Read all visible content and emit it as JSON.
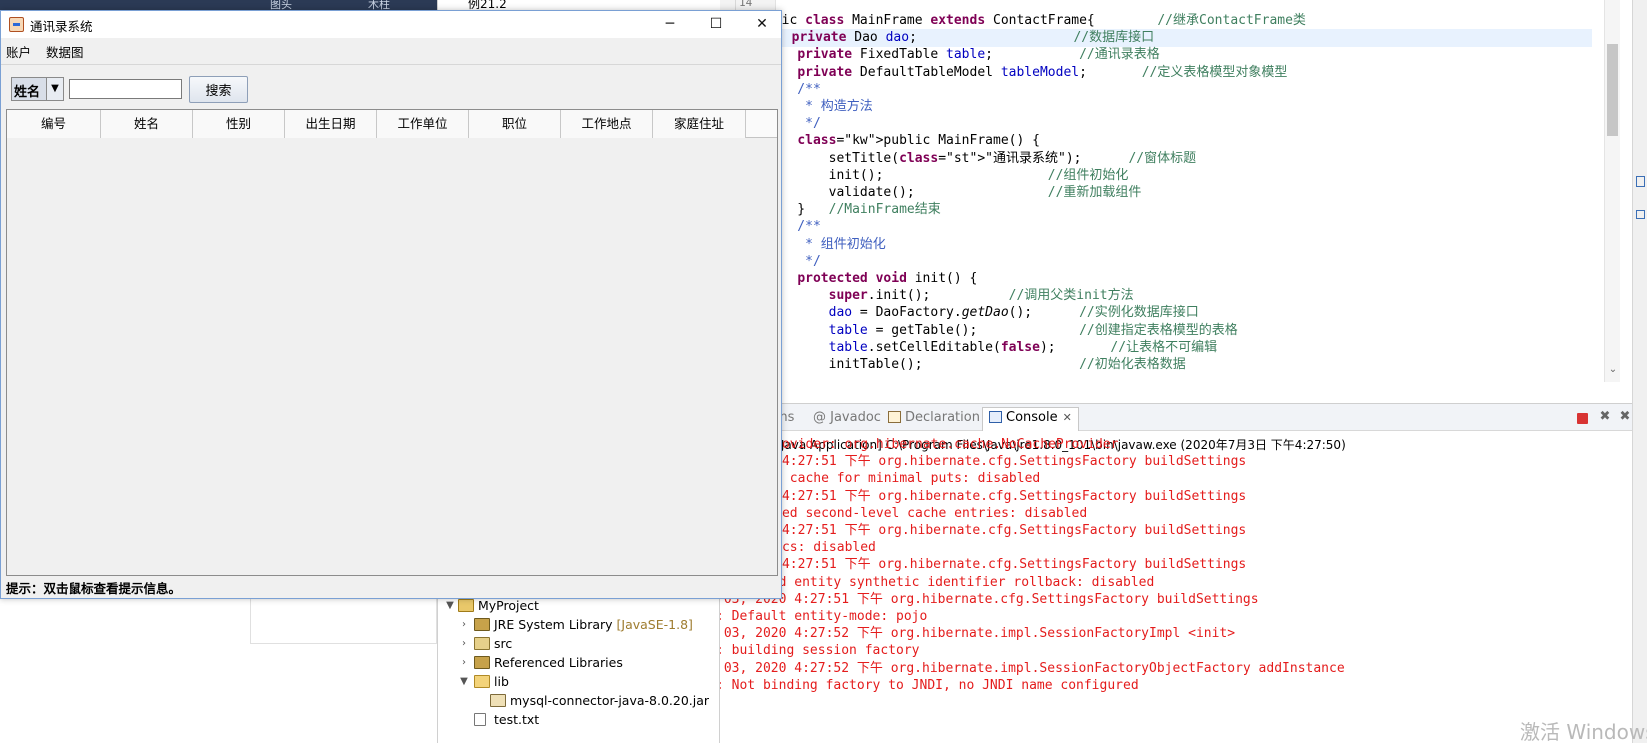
{
  "ide": {
    "top_strip": {
      "left_text": "图头",
      "right_text": "木柱"
    },
    "line_number": "14",
    "explorer_top_item": "例21.2",
    "code_lines": [
      "public class MainFrame extends ContactFrame{        //继承ContactFrame类",
      "    private Dao dao;                    //数据库接口",
      "    private FixedTable table;           //通讯录表格",
      "    private DefaultTableModel tableModel;       //定义表格模型对象模型",
      "    /**",
      "     * 构造方法",
      "     */",
      "    public MainFrame() {",
      "        setTitle(\"通讯录系统\");      //窗体标题",
      "        init();                     //组件初始化",
      "        validate();                 //重新加载组件",
      "    }   //MainFrame结束",
      "    /**",
      "     * 组件初始化",
      "     */",
      "    protected void init() {",
      "        super.init();          //调用父类init方法",
      "        dao = DaoFactory.getDao();      //实例化数据库接口",
      "        table = getTable();             //创建指定表格模型的表格",
      "        table.setCellEditable(false);       //让表格不可编辑",
      "        initTable();                    //初始化表格数据"
    ],
    "console": {
      "tabs": [
        "ms",
        "@ Javadoc",
        "Declaration",
        "Console"
      ],
      "header": "e [Java Application] C:\\Program Files\\Java\\jre1.8.0_101\\bin\\javaw.exe  (2020年7月3日 下午4:27:50)",
      "lines": [
        "che provider: org.hibernate.cache.NoCacheProvider",
        " 2020 4:27:51 下午 org.hibernate.cfg.SettingsFactory buildSettings",
        "timize cache for minimal puts: disabled",
        " 2020 4:27:51 下午 org.hibernate.cfg.SettingsFactory buildSettings",
        "ructured second-level cache entries: disabled",
        " 2020 4:27:51 下午 org.hibernate.cfg.SettingsFactory buildSettings",
        "atistics: disabled",
        " 2020 4:27:51 下午 org.hibernate.cfg.SettingsFactory buildSettings",
        "信息: Deleted entity synthetic identifier rollback: disabled",
        "七月 03, 2020 4:27:51 下午 org.hibernate.cfg.SettingsFactory buildSettings",
        "信息: Default entity-mode: pojo",
        "七月 03, 2020 4:27:52 下午 org.hibernate.impl.SessionFactoryImpl <init>",
        "信息: building session factory",
        "七月 03, 2020 4:27:52 下午 org.hibernate.impl.SessionFactoryObjectFactory addInstance",
        "信息: Not binding factory to JNDI, no JNDI name configured"
      ]
    },
    "explorer": {
      "project": "MyProject",
      "jre": "JRE System Library",
      "jre_decoration": "[JavaSE-1.8]",
      "src": "src",
      "referenced": "Referenced Libraries",
      "lib": "lib",
      "jar": "mysql-connector-java-8.0.20.jar",
      "txt": "test.txt"
    },
    "watermark": "激活 Windows"
  },
  "app": {
    "title": "通讯录系统",
    "window_buttons": {
      "minimize": "─",
      "maximize": "☐",
      "close": "✕"
    },
    "menu": [
      "账户",
      "数据图"
    ],
    "search": {
      "field_selected": "姓名",
      "input_value": "",
      "button_label": "搜索"
    },
    "table": {
      "columns": [
        "编号",
        "姓名",
        "性别",
        "出生日期",
        "工作单位",
        "职位",
        "工作地点",
        "家庭住址"
      ]
    },
    "status": "提示：双击鼠标查看提示信息。"
  }
}
